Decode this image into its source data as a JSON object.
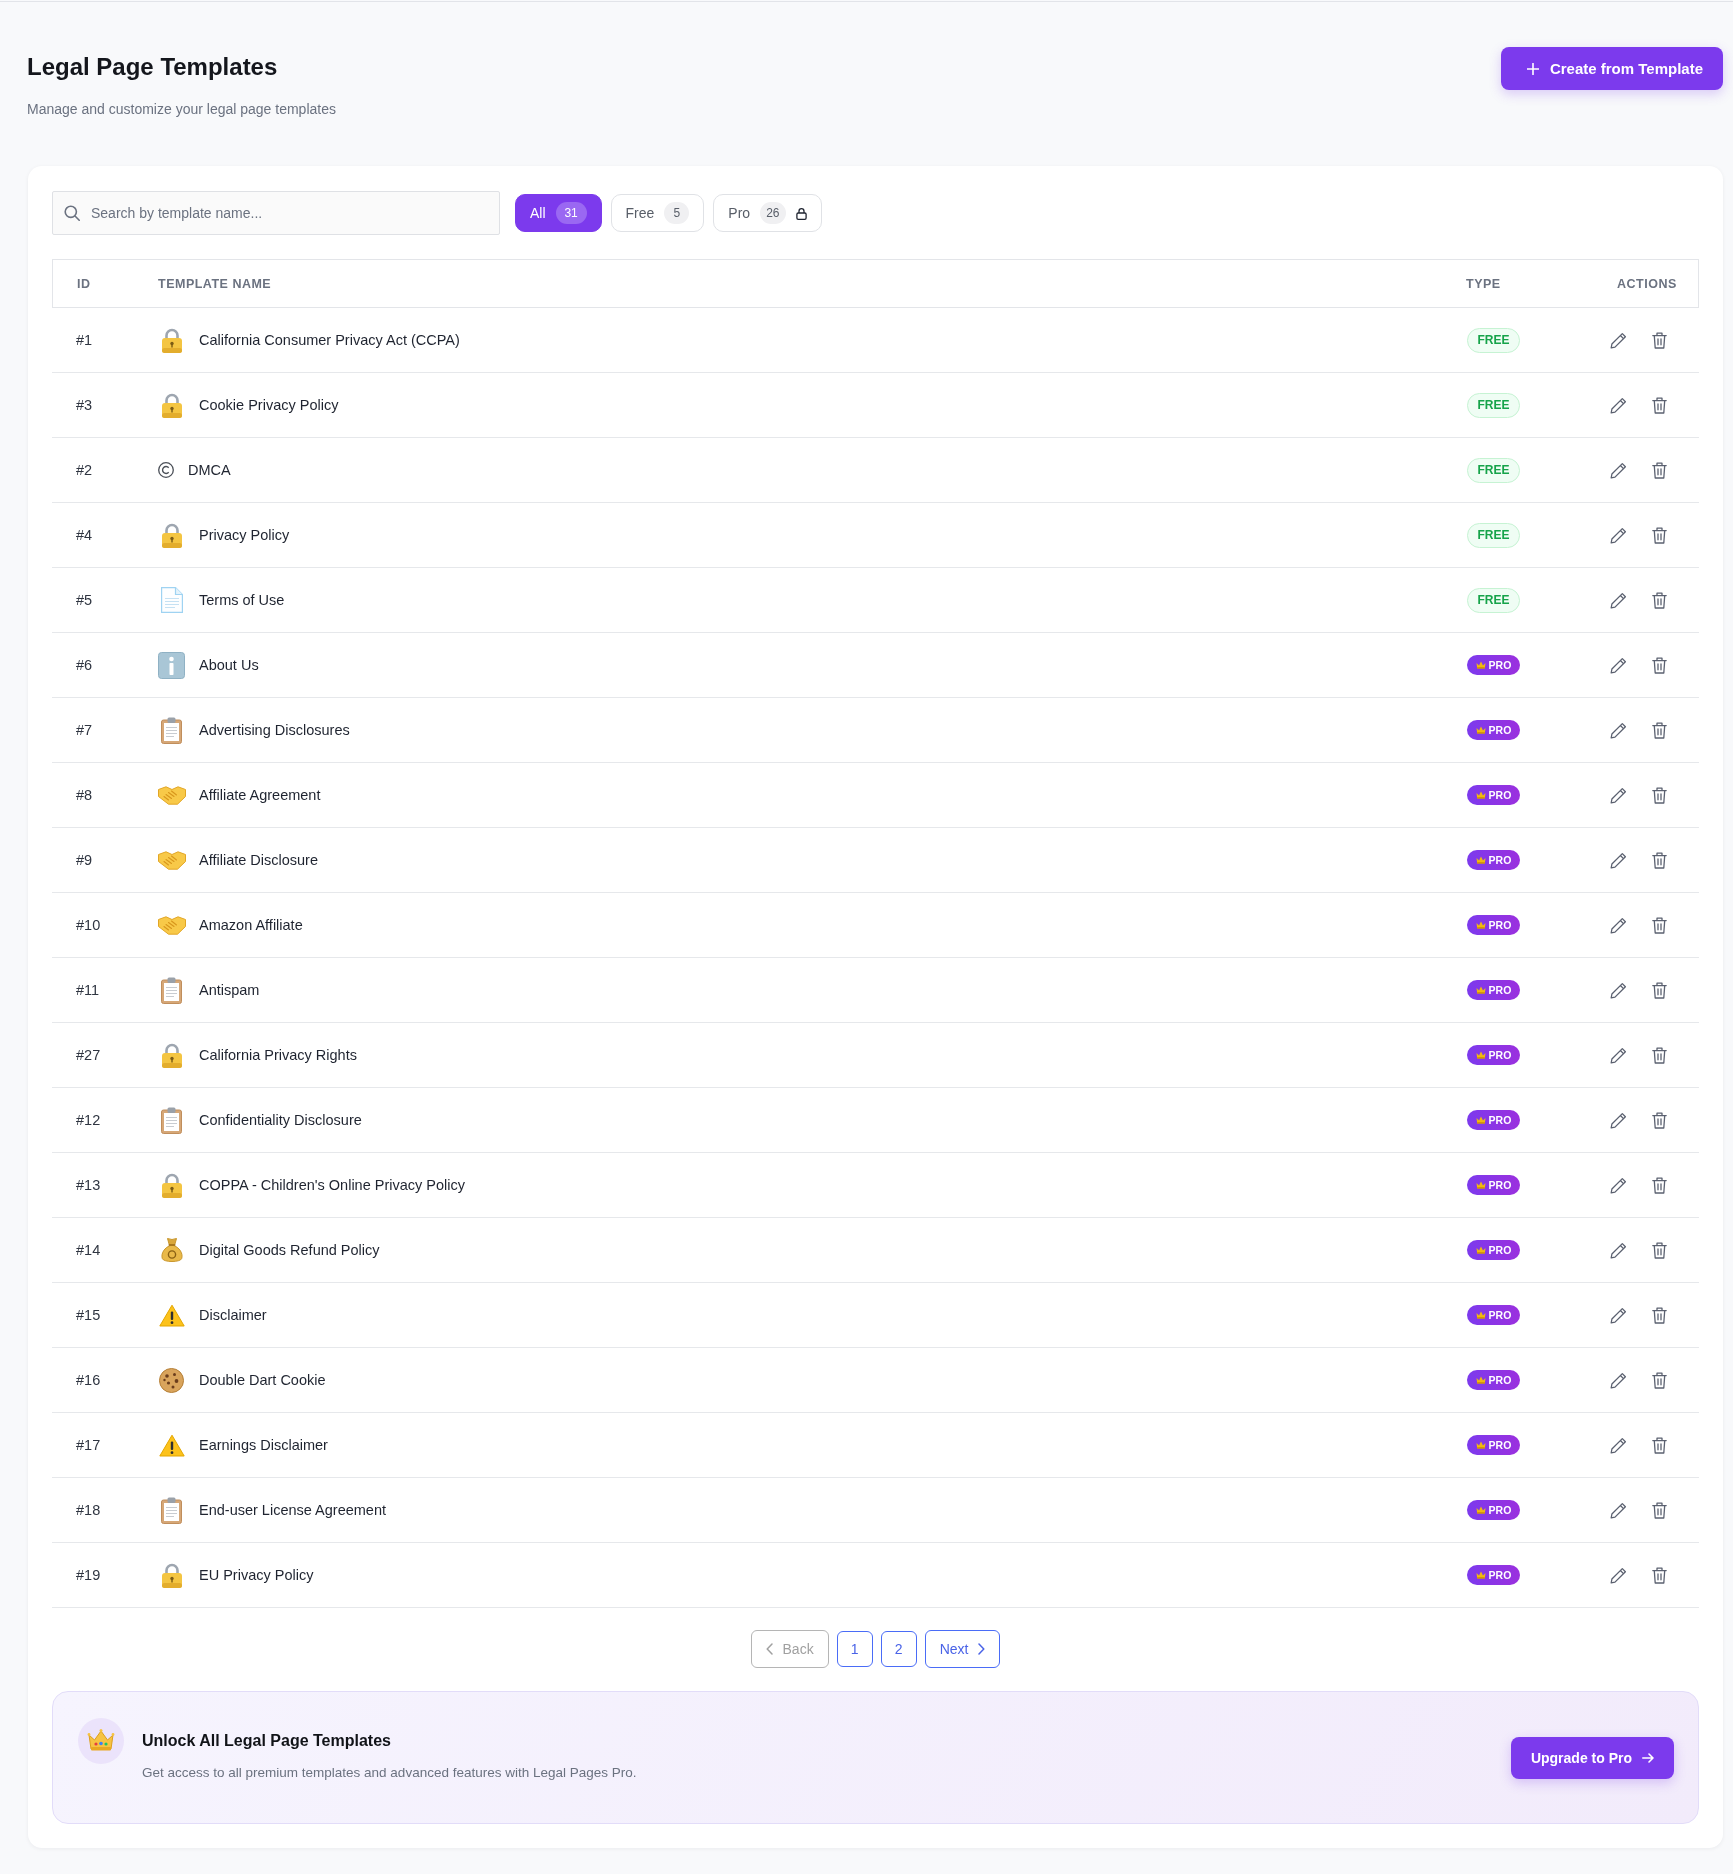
{
  "header": {
    "title": "Legal Page Templates",
    "subtitle": "Manage and customize your legal page templates",
    "button": "Create from Template"
  },
  "search": {
    "placeholder": "Search by template name..."
  },
  "filters": [
    {
      "label": "All",
      "count": "31",
      "selected": true,
      "locked": false
    },
    {
      "label": "Free",
      "count": "5",
      "selected": false,
      "locked": false
    },
    {
      "label": "Pro",
      "count": "26",
      "selected": false,
      "locked": true
    }
  ],
  "table": {
    "columns": [
      "ID",
      "TEMPLATE NAME",
      "TYPE",
      "ACTIONS"
    ],
    "rows": [
      {
        "id": "#1",
        "kind": "lock",
        "name": "California Consumer Privacy Act (CCPA)",
        "type": {
          "label": "FREE",
          "kind": "free"
        }
      },
      {
        "id": "#3",
        "kind": "lock",
        "name": "Cookie Privacy Policy",
        "type": {
          "label": "FREE",
          "kind": "free"
        }
      },
      {
        "id": "#2",
        "kind": "copyright",
        "name": "DMCA",
        "type": {
          "label": "FREE",
          "kind": "free"
        }
      },
      {
        "id": "#4",
        "kind": "lock",
        "name": "Privacy Policy",
        "type": {
          "label": "FREE",
          "kind": "free"
        }
      },
      {
        "id": "#5",
        "kind": "document",
        "name": "Terms of Use",
        "type": {
          "label": "FREE",
          "kind": "free"
        }
      },
      {
        "id": "#6",
        "kind": "info",
        "name": "About Us",
        "type": {
          "label": "PRO",
          "kind": "pro"
        }
      },
      {
        "id": "#7",
        "kind": "clipboard",
        "name": "Advertising Disclosures",
        "type": {
          "label": "PRO",
          "kind": "pro"
        }
      },
      {
        "id": "#8",
        "kind": "handshake",
        "name": "Affiliate Agreement",
        "type": {
          "label": "PRO",
          "kind": "pro"
        }
      },
      {
        "id": "#9",
        "kind": "handshake",
        "name": "Affiliate Disclosure",
        "type": {
          "label": "PRO",
          "kind": "pro"
        }
      },
      {
        "id": "#10",
        "kind": "handshake",
        "name": "Amazon Affiliate",
        "type": {
          "label": "PRO",
          "kind": "pro"
        }
      },
      {
        "id": "#11",
        "kind": "clipboard",
        "name": "Antispam",
        "type": {
          "label": "PRO",
          "kind": "pro"
        }
      },
      {
        "id": "#27",
        "kind": "lock",
        "name": "California Privacy Rights",
        "type": {
          "label": "PRO",
          "kind": "pro"
        }
      },
      {
        "id": "#12",
        "kind": "clipboard",
        "name": "Confidentiality Disclosure",
        "type": {
          "label": "PRO",
          "kind": "pro"
        }
      },
      {
        "id": "#13",
        "kind": "lock",
        "name": "COPPA - Children's Online Privacy Policy",
        "type": {
          "label": "PRO",
          "kind": "pro"
        }
      },
      {
        "id": "#14",
        "kind": "money",
        "name": "Digital Goods Refund Policy",
        "type": {
          "label": "PRO",
          "kind": "pro"
        }
      },
      {
        "id": "#15",
        "kind": "warning",
        "name": "Disclaimer",
        "type": {
          "label": "PRO",
          "kind": "pro"
        }
      },
      {
        "id": "#16",
        "kind": "cookie",
        "name": "Double Dart Cookie",
        "type": {
          "label": "PRO",
          "kind": "pro"
        }
      },
      {
        "id": "#17",
        "kind": "warning",
        "name": "Earnings Disclaimer",
        "type": {
          "label": "PRO",
          "kind": "pro"
        }
      },
      {
        "id": "#18",
        "kind": "clipboard",
        "name": "End-user License Agreement",
        "type": {
          "label": "PRO",
          "kind": "pro"
        }
      },
      {
        "id": "#19",
        "kind": "lock",
        "name": "EU Privacy Policy",
        "type": {
          "label": "PRO",
          "kind": "pro"
        }
      }
    ]
  },
  "pagination": {
    "back": {
      "label": "Back",
      "disabled": true
    },
    "pages": [
      "1",
      "2"
    ],
    "next": {
      "label": "Next",
      "disabled": false
    }
  },
  "upgrade_banner": {
    "title": "Unlock All Legal Page Templates",
    "text": "Get access to all premium templates and advanced features with Legal Pages Pro.",
    "button": "Upgrade to Pro"
  }
}
